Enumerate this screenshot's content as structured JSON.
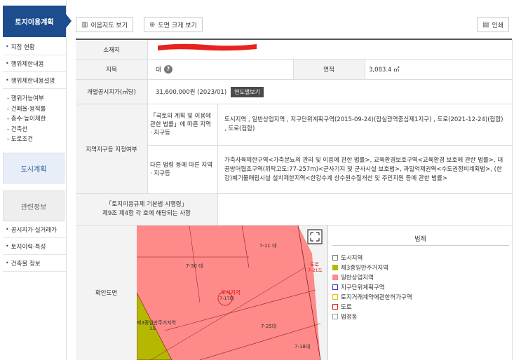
{
  "sidebar": {
    "header": "토지이용계획",
    "items": [
      "지정 현황",
      "행위제한내용",
      "행위제한내용설명"
    ],
    "sub_items": [
      "행위가능여부",
      "건폐율·용적률",
      "층수·높이제한",
      "건축선",
      "도로조건"
    ],
    "city_plan": "도시계획",
    "related": "관련정보",
    "related_items": [
      "공시지가·실거래가",
      "토지이력·특성",
      "건축물 정보"
    ]
  },
  "toolbar": {
    "map_view": "이음지도 보기",
    "zoom_view": "도면 크게 보기",
    "print": "인쇄"
  },
  "info": {
    "location_label": "소재지",
    "jimok_label": "지목",
    "jimok_value": "대",
    "jimok_help": "?",
    "area_label": "면적",
    "area_value": "3,083.4 ㎡",
    "price_label": "개별공시지가(㎡당)",
    "price_value": "31,600,000원 (2023/01)",
    "price_btn": "연도별보기",
    "zone_label": "지역지구등 지정여부",
    "zone_law1_label": "「국토의 계획 및 이용에 관한 법률」에 따른 지역 · 지구등",
    "zone_law1_value": "도시지역 , 일반상업지역 , 지구단위계획구역(2015-09-24)(잠실광역중심제1지구) , 도로(2021-12-24)(접합) , 도로(접합)",
    "zone_law2_label": "다른 법령 등에 따른 지역 · 지구등",
    "zone_law2_value": "가축사육제한구역<가축분뇨의 관리 및 이용에 관한 법률>, 교육환경보호구역<교육환경 보호에 관한 법률>, 대공방어협조구역(위탁고도:77-257m)<군사기지 및 군사시설 보호법>, 과밀억제권역<수도권정비계획법>, (한강)폐기물매립시설 설치제한지역<한강수계 상수원수질개선 및 주민지원 등에 관한 법률>",
    "enforce_label_1": "「토지이용규제 기본법 시행령」",
    "enforce_label_2": "제9조 제4항 각 호에 해당되는 사항",
    "map_label": "확인도면"
  },
  "map": {
    "labels": [
      "7-11 대",
      "7-30 대",
      "도로",
      "7-21도",
      "도시지역",
      "7-17대",
      "제3종일반주거지역",
      "3도",
      "7-25대",
      "7-18대"
    ]
  },
  "legend": {
    "title": "범례",
    "items": [
      {
        "label": "도시지역",
        "color": "#ffffff"
      },
      {
        "label": "제3종일반주거지역",
        "color": "#b5b800"
      },
      {
        "label": "일반상업지역",
        "color": "#ff8a8a"
      },
      {
        "label": "지구단위계획구역",
        "color": "#ffffff"
      },
      {
        "label": "토지거래계약에관한허가구역",
        "color": "#ffffff"
      },
      {
        "label": "도로",
        "color": "#ffffff"
      },
      {
        "label": "법정동",
        "color": "#ffffff"
      }
    ]
  },
  "colors": {
    "brand": "#1d4d8e",
    "commercial": "#ff8a8a",
    "residential": "#b5b800"
  }
}
